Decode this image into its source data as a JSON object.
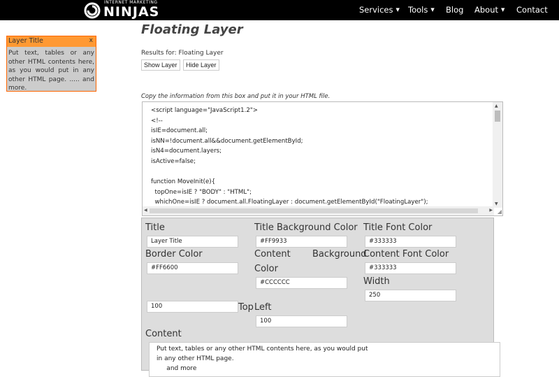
{
  "header": {
    "logo_small": "INTERNET MARKETING",
    "logo_big": "NINJAS",
    "nav": [
      {
        "label": "Services",
        "dropdown": true
      },
      {
        "label": "Tools",
        "dropdown": true
      },
      {
        "label": "Blog",
        "dropdown": false
      },
      {
        "label": "About",
        "dropdown": true
      },
      {
        "label": "Contact",
        "dropdown": false
      }
    ]
  },
  "preview": {
    "title": "Layer Title",
    "close": "x",
    "body": "Put text, tables or any other HTML contents here, as you would put in any other HTML page. ..... and more.",
    "colors": {
      "title_bg": "#FF9933",
      "border": "#FF6600",
      "content_bg": "#CCCCCC",
      "font": "#333333"
    }
  },
  "main": {
    "title": "Floating Layer",
    "results": "Results for: Floating Layer",
    "show_label": "Show Layer",
    "hide_label": "Hide Layer",
    "copy_note": "Copy the information from this box and put it in your HTML file.",
    "code": "<script language=\"JavaScript1.2\">\n<!--\nisIE=document.all;\nisNN=!document.all&&document.getElementById;\nisN4=document.layers;\nisActive=false;\n\nfunction MoveInit(e){\n  topOne=isIE ? \"BODY\" : \"HTML\";\n  whichOne=isIE ? document.all.FloatingLayer : document.getElementById(\"FloatingLayer\");"
  },
  "form": {
    "title_label": "Title",
    "title_value": "Layer Title",
    "title_bg_label": "Title Background Color",
    "title_bg_value": "#FF9933",
    "title_font_label": "Title Font Color",
    "title_font_value": "#333333",
    "border_label": "Border Color",
    "border_value": "#FF6600",
    "content_bg_label_1": "Content",
    "content_bg_label_2": "Color",
    "content_bg_label_3": "Background",
    "content_bg_value": "#CCCCCC",
    "content_font_label": "Content Font Color",
    "content_font_value": "#333333",
    "width_label": "Width",
    "width_value": "250",
    "top_value": "100",
    "top_label": "Top",
    "left_label": "Left",
    "left_value": "100",
    "content_label": "Content",
    "content_value": "Put text, tables or any other HTML contents here, as you would put\nin any other HTML page.\n     and more"
  }
}
